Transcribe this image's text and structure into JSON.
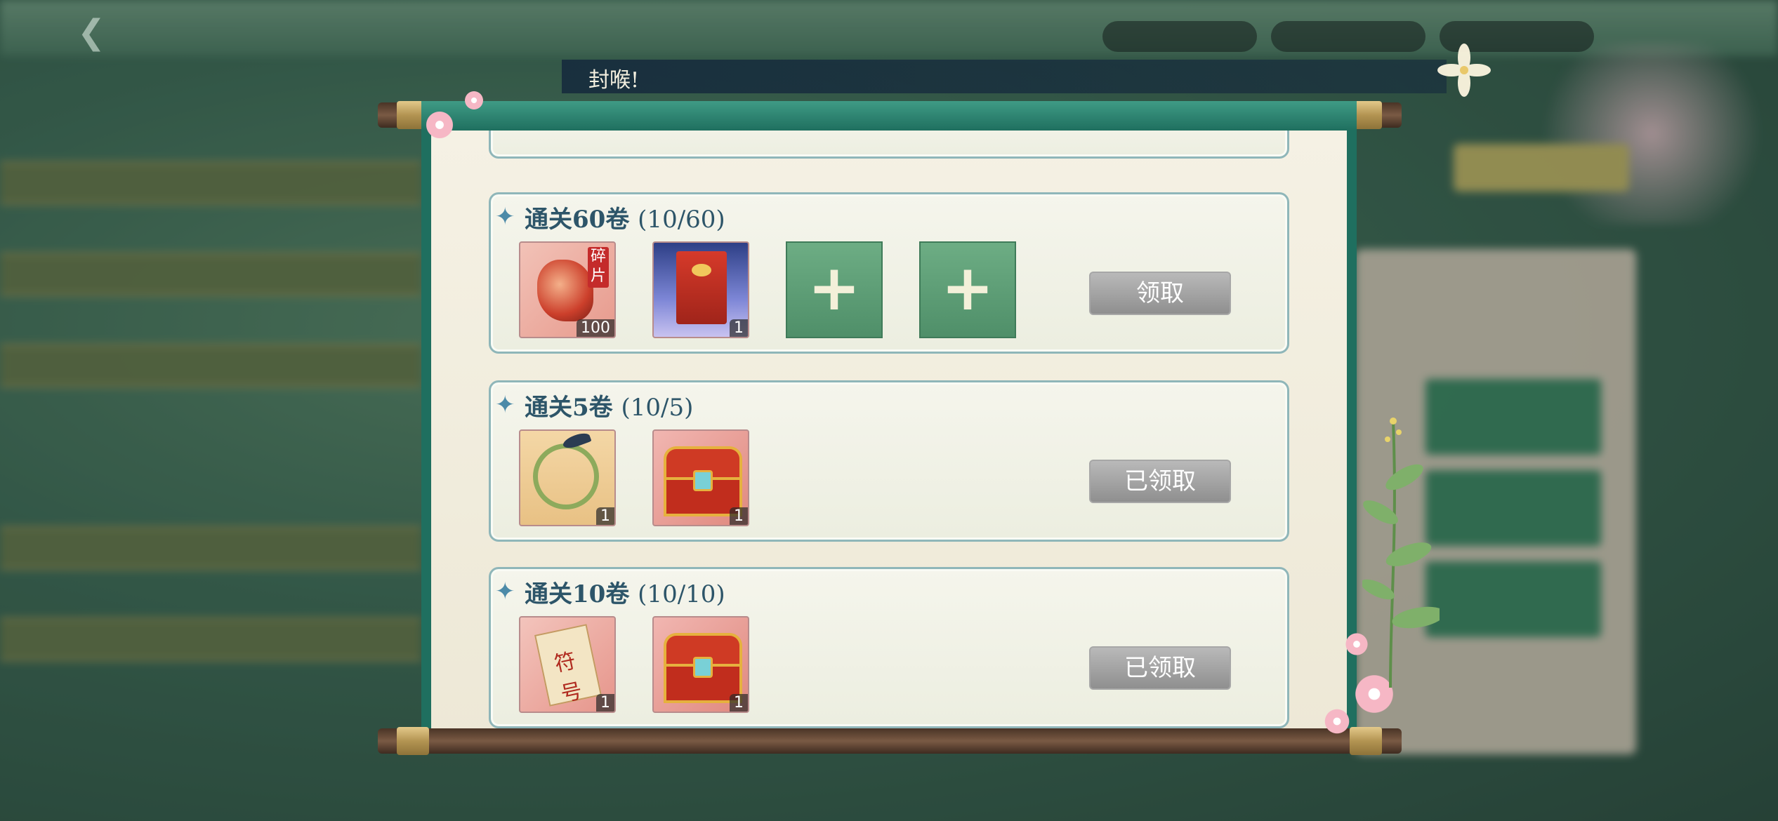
{
  "notice": {
    "text": "封喉!"
  },
  "tasks": [
    {
      "title": "通关60卷",
      "progress": "(10/60)",
      "button": "领取",
      "rewards": [
        {
          "icon": "fragment-icon",
          "tag": "碎片",
          "qty": "100"
        },
        {
          "icon": "red-envelope-icon",
          "qty": "1"
        },
        {
          "icon": "empty-slot",
          "qty": ""
        },
        {
          "icon": "empty-slot",
          "qty": ""
        }
      ]
    },
    {
      "title": "通关5卷",
      "progress": "(10/5)",
      "button": "已领取",
      "rewards": [
        {
          "icon": "wreath-icon",
          "qty": "1"
        },
        {
          "icon": "treasure-chest-icon",
          "qty": "1"
        }
      ]
    },
    {
      "title": "通关10卷",
      "progress": "(10/10)",
      "button": "已领取",
      "rewards": [
        {
          "icon": "talisman-paper-icon",
          "ink": "符号",
          "qty": "1"
        },
        {
          "icon": "treasure-chest-icon",
          "qty": "1"
        }
      ]
    }
  ],
  "colors": {
    "scroll_green": "#1f6f5f",
    "card_border": "#8fb6b9",
    "button_gray": "#a3a3a3",
    "title_blue": "#2d5569"
  }
}
